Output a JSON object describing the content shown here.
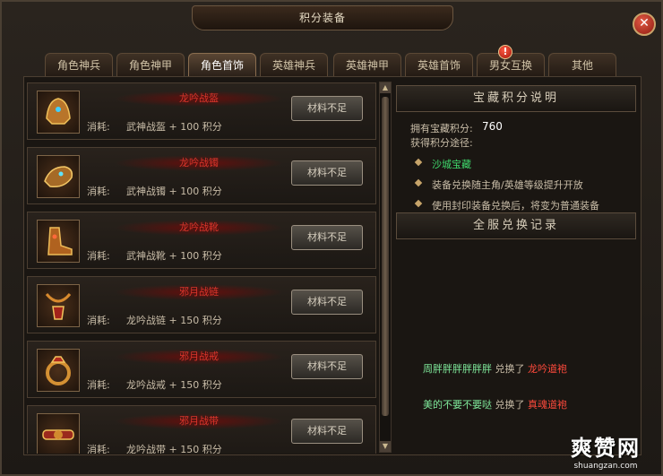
{
  "window": {
    "title": "积分装备"
  },
  "tabs": [
    {
      "label": "角色神兵",
      "active": false
    },
    {
      "label": "角色神甲",
      "active": false
    },
    {
      "label": "角色首饰",
      "active": true
    },
    {
      "label": "英雄神兵",
      "active": false
    },
    {
      "label": "英雄神甲",
      "active": false
    },
    {
      "label": "英雄首饰",
      "active": false
    },
    {
      "label": "男女互换",
      "active": false
    },
    {
      "label": "其他",
      "active": false
    }
  ],
  "alert_badge": "!",
  "items": [
    {
      "name": "龙吟战盔",
      "cost_label": "消耗:",
      "cost_text": "武神战盔 + 100 积分",
      "button": "材料不足"
    },
    {
      "name": "龙吟战镯",
      "cost_label": "消耗:",
      "cost_text": "武神战镯 + 100 积分",
      "button": "材料不足"
    },
    {
      "name": "龙吟战靴",
      "cost_label": "消耗:",
      "cost_text": "武神战靴 + 100 积分",
      "button": "材料不足"
    },
    {
      "name": "邪月战链",
      "cost_label": "消耗:",
      "cost_text": "龙吟战链 + 150 积分",
      "button": "材料不足"
    },
    {
      "name": "邪月战戒",
      "cost_label": "消耗:",
      "cost_text": "龙吟战戒 + 150 积分",
      "button": "材料不足"
    },
    {
      "name": "邪月战带",
      "cost_label": "消耗:",
      "cost_text": "龙吟战带 + 150 积分",
      "button": "材料不足"
    }
  ],
  "info_panel": {
    "header": "宝藏积分说明",
    "owned_label": "拥有宝藏积分:",
    "owned_value": "760",
    "methods_label": "获得积分途径:",
    "methods": [
      {
        "text": "沙城宝藏",
        "color": "#3fd86b"
      },
      {
        "text": "装备兑换随主角/英雄等级提升开放",
        "color": "#c9bda8"
      },
      {
        "text": "使用封印装备兑换后，将变为普通装备",
        "color": "#c9bda8"
      }
    ]
  },
  "log_panel": {
    "header": "全服兑换记录",
    "entries": [
      {
        "player": "周胖胖胖胖胖胖",
        "verb": "兑换了",
        "reward": "龙吟道袍"
      },
      {
        "player": "美的不要不要哒",
        "verb": "兑换了",
        "reward": "真魂道袍"
      }
    ]
  },
  "watermark": {
    "main": "爽赞网",
    "sub": "shuangzan.com"
  },
  "colors": {
    "accent_red": "#d9352b",
    "player_green": "#7fe89a",
    "reward_red": "#ff4a3c"
  }
}
